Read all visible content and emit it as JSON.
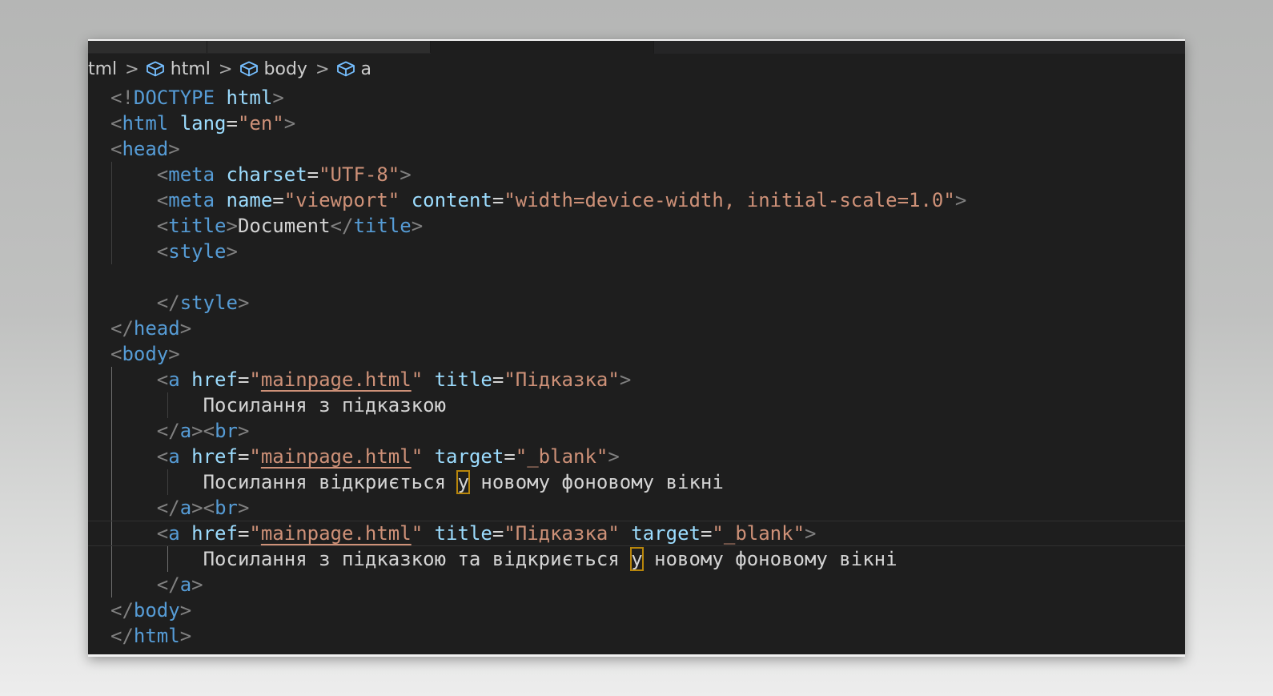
{
  "breadcrumb": {
    "file_partial": "tml",
    "items": [
      {
        "label": "html",
        "icon": "cube-icon"
      },
      {
        "label": "body",
        "icon": "cube-icon"
      },
      {
        "label": "a",
        "icon": "cube-icon"
      }
    ]
  },
  "code_lines": [
    [
      [
        "t",
        "<!"
      ],
      [
        "tn",
        "DOCTYPE"
      ],
      [
        "tx",
        " "
      ],
      [
        "an",
        "html"
      ],
      [
        "t",
        ">"
      ]
    ],
    [
      [
        "t",
        "<"
      ],
      [
        "tn",
        "html"
      ],
      [
        "tx",
        " "
      ],
      [
        "an",
        "lang"
      ],
      [
        "tx",
        "="
      ],
      [
        "av",
        "\"en\""
      ],
      [
        "t",
        ">"
      ]
    ],
    [
      [
        "t",
        "<"
      ],
      [
        "tn",
        "head"
      ],
      [
        "t",
        ">"
      ]
    ],
    [
      [
        "tx",
        "    "
      ],
      [
        "t",
        "<"
      ],
      [
        "tn",
        "meta"
      ],
      [
        "tx",
        " "
      ],
      [
        "an",
        "charset"
      ],
      [
        "tx",
        "="
      ],
      [
        "av",
        "\"UTF-8\""
      ],
      [
        "t",
        ">"
      ]
    ],
    [
      [
        "tx",
        "    "
      ],
      [
        "t",
        "<"
      ],
      [
        "tn",
        "meta"
      ],
      [
        "tx",
        " "
      ],
      [
        "an",
        "name"
      ],
      [
        "tx",
        "="
      ],
      [
        "av",
        "\"viewport\""
      ],
      [
        "tx",
        " "
      ],
      [
        "an",
        "content"
      ],
      [
        "tx",
        "="
      ],
      [
        "av",
        "\"width=device-width, initial-scale=1.0\""
      ],
      [
        "t",
        ">"
      ]
    ],
    [
      [
        "tx",
        "    "
      ],
      [
        "t",
        "<"
      ],
      [
        "tn",
        "title"
      ],
      [
        "t",
        ">"
      ],
      [
        "tx",
        "Document"
      ],
      [
        "t",
        "</"
      ],
      [
        "tn",
        "title"
      ],
      [
        "t",
        ">"
      ]
    ],
    [
      [
        "tx",
        "    "
      ],
      [
        "t",
        "<"
      ],
      [
        "tn",
        "style"
      ],
      [
        "t",
        ">"
      ]
    ],
    [],
    [
      [
        "tx",
        "    "
      ],
      [
        "t",
        "</"
      ],
      [
        "tn",
        "style"
      ],
      [
        "t",
        ">"
      ]
    ],
    [
      [
        "t",
        "</"
      ],
      [
        "tn",
        "head"
      ],
      [
        "t",
        ">"
      ]
    ],
    [
      [
        "t",
        "<"
      ],
      [
        "tn",
        "body"
      ],
      [
        "t",
        ">"
      ]
    ],
    [
      [
        "tx",
        "    "
      ],
      [
        "t",
        "<"
      ],
      [
        "tn",
        "a"
      ],
      [
        "tx",
        " "
      ],
      [
        "an",
        "href"
      ],
      [
        "tx",
        "="
      ],
      [
        "av",
        "\""
      ],
      [
        "av link",
        "mainpage.html"
      ],
      [
        "av",
        "\""
      ],
      [
        "tx",
        " "
      ],
      [
        "an",
        "title"
      ],
      [
        "tx",
        "="
      ],
      [
        "av",
        "\"Підказка\""
      ],
      [
        "t",
        ">"
      ]
    ],
    [
      [
        "tx",
        "        Посилання з підказкою"
      ]
    ],
    [
      [
        "tx",
        "    "
      ],
      [
        "t",
        "</"
      ],
      [
        "tn",
        "a"
      ],
      [
        "t",
        "><"
      ],
      [
        "tn",
        "br"
      ],
      [
        "t",
        ">"
      ]
    ],
    [
      [
        "tx",
        "    "
      ],
      [
        "t",
        "<"
      ],
      [
        "tn",
        "a"
      ],
      [
        "tx",
        " "
      ],
      [
        "an",
        "href"
      ],
      [
        "tx",
        "="
      ],
      [
        "av",
        "\""
      ],
      [
        "av link",
        "mainpage.html"
      ],
      [
        "av",
        "\""
      ],
      [
        "tx",
        " "
      ],
      [
        "an",
        "target"
      ],
      [
        "tx",
        "="
      ],
      [
        "av",
        "\"_blank\""
      ],
      [
        "t",
        ">"
      ]
    ],
    [
      [
        "tx",
        "        Посилання відкриється "
      ],
      [
        "tx hl",
        "у"
      ],
      [
        "tx",
        " новому фоновому вікні"
      ]
    ],
    [
      [
        "tx",
        "    "
      ],
      [
        "t",
        "</"
      ],
      [
        "tn",
        "a"
      ],
      [
        "t",
        "><"
      ],
      [
        "tn",
        "br"
      ],
      [
        "t",
        ">"
      ]
    ],
    [
      [
        "tx",
        "    "
      ],
      [
        "t",
        "<"
      ],
      [
        "tn",
        "a"
      ],
      [
        "tx",
        " "
      ],
      [
        "an",
        "href"
      ],
      [
        "tx",
        "="
      ],
      [
        "av",
        "\""
      ],
      [
        "av link",
        "mainpage.html"
      ],
      [
        "av",
        "\""
      ],
      [
        "tx",
        " "
      ],
      [
        "an",
        "title"
      ],
      [
        "tx",
        "="
      ],
      [
        "av",
        "\"Підказка\""
      ],
      [
        "tx",
        " "
      ],
      [
        "an",
        "target"
      ],
      [
        "tx",
        "="
      ],
      [
        "av",
        "\"_blank\""
      ],
      [
        "t",
        ">"
      ]
    ],
    [
      [
        "tx",
        "        Посилання з підказкою та відкриється "
      ],
      [
        "tx hl",
        "у"
      ],
      [
        "tx",
        " новому фоновому вікні"
      ]
    ],
    [
      [
        "tx",
        "    "
      ],
      [
        "t",
        "</"
      ],
      [
        "tn",
        "a"
      ],
      [
        "t",
        ">"
      ]
    ],
    [
      [
        "t",
        "</"
      ],
      [
        "tn",
        "body"
      ],
      [
        "t",
        ">"
      ]
    ],
    [
      [
        "t",
        "</"
      ],
      [
        "tn",
        "html"
      ],
      [
        "t",
        ">"
      ]
    ]
  ],
  "current_line": 17
}
